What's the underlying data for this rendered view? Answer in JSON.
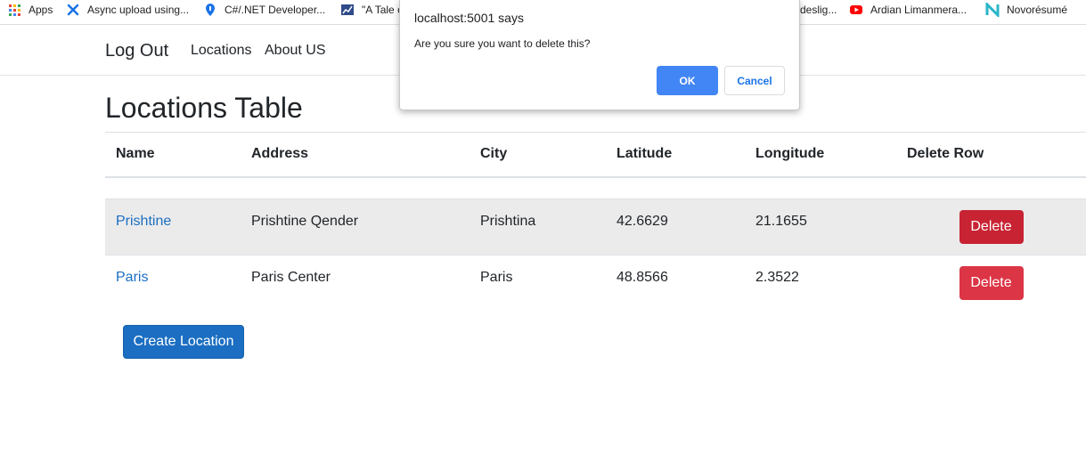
{
  "bookmarks": [
    {
      "label": "Apps",
      "icon": "apps-grid-icon"
    },
    {
      "label": "Async upload using...",
      "icon": "blue-x-icon"
    },
    {
      "label": "C#/.NET Developer...",
      "icon": "info-pin-icon"
    },
    {
      "label": "\"A Tale o",
      "icon": "chart-icon"
    },
    {
      "label": "deslig...",
      "icon": "partial-site-icon"
    },
    {
      "label": "Ardian Limanmera...",
      "icon": "youtube-icon"
    },
    {
      "label": "Novorésumé",
      "icon": "novoresume-n-icon"
    }
  ],
  "colors": {
    "link": "#1b6ec2",
    "delete_button": "#dc3545",
    "delete_button_active": "#c82333",
    "primary_button": "#1b6ec2",
    "dialog_ok": "#4285f4"
  },
  "navbar": {
    "brand": "Log Out",
    "links": [
      "Locations",
      "About US"
    ]
  },
  "page": {
    "title": "Locations Table"
  },
  "table": {
    "headers": [
      "Name",
      "Address",
      "City",
      "Latitude",
      "Longitude",
      "Delete Row"
    ],
    "rows": [
      {
        "name": "Prishtine",
        "address": "Prishtine Qender",
        "city": "Prishtina",
        "latitude": "42.6629",
        "longitude": "21.1655",
        "delete_label": "Delete"
      },
      {
        "name": "Paris",
        "address": "Paris Center",
        "city": "Paris",
        "latitude": "48.8566",
        "longitude": "2.3522",
        "delete_label": "Delete"
      }
    ]
  },
  "create_button": "Create Location",
  "dialog": {
    "title": "localhost:5001 says",
    "message": "Are you sure you want to delete this?",
    "ok": "OK",
    "cancel": "Cancel"
  }
}
